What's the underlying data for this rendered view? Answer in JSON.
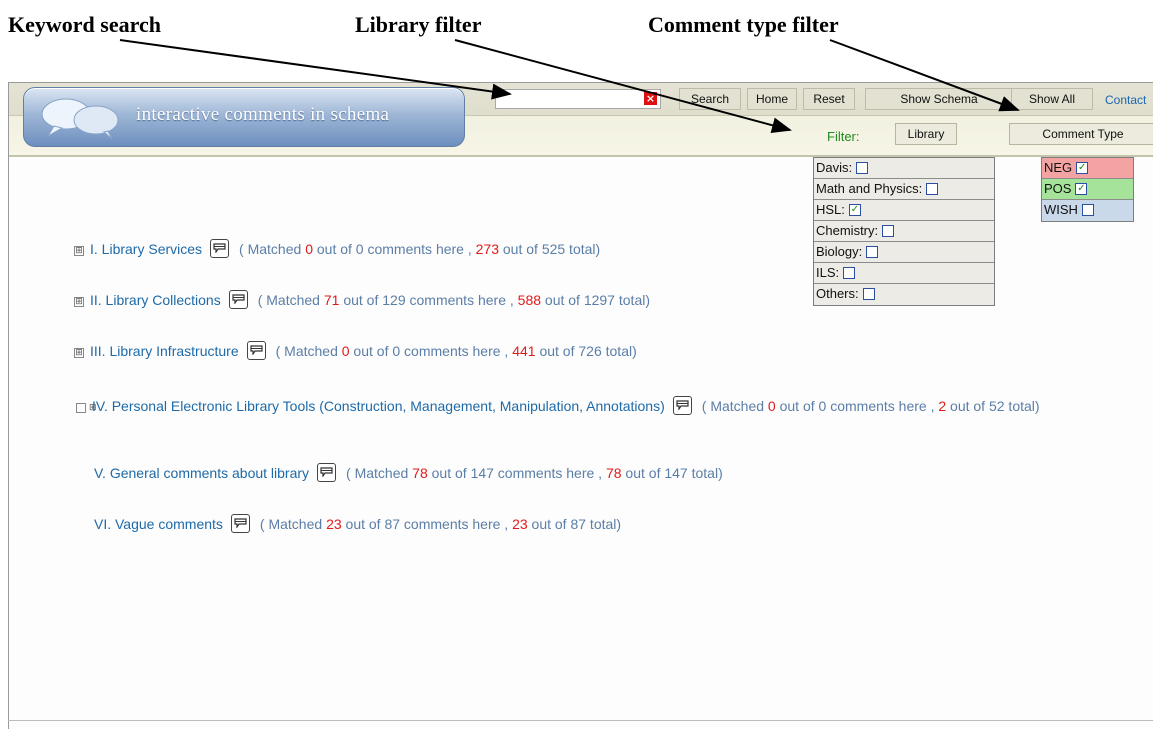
{
  "annotations": {
    "keyword_search": "Keyword search",
    "library_filter": "Library filter",
    "comment_type_filter": "Comment type filter"
  },
  "header": {
    "logo_text": "interactive comments in schema",
    "search_value": "",
    "buttons": {
      "search": "Search",
      "home": "Home",
      "reset": "Reset",
      "show_schema": "Show Schema",
      "show_all": "Show All"
    },
    "contact": "Contact",
    "filter_label": "Filter:",
    "library_button": "Library",
    "comment_type_button": "Comment Type"
  },
  "library_filter": {
    "items": [
      {
        "label": "Davis:",
        "checked": false
      },
      {
        "label": "Math and Physics:",
        "checked": false
      },
      {
        "label": "HSL:",
        "checked": true
      },
      {
        "label": "Chemistry:",
        "checked": false
      },
      {
        "label": "Biology:",
        "checked": false
      },
      {
        "label": "ILS:",
        "checked": false
      },
      {
        "label": "Others:",
        "checked": false
      }
    ]
  },
  "comment_type_filter": {
    "items": [
      {
        "label": "NEG",
        "checked": true,
        "color": "#f4a3a3"
      },
      {
        "label": "POS",
        "checked": true,
        "color": "#a6e39a"
      },
      {
        "label": "WISH",
        "checked": false,
        "color": "#c9d9ea"
      }
    ]
  },
  "tree": {
    "nodes": [
      {
        "title": "I. Library Services",
        "matched": "0",
        "here": "0",
        "total_matched": "273",
        "total": "525"
      },
      {
        "title": "II. Library Collections",
        "matched": "71",
        "here": "129",
        "total_matched": "588",
        "total": "1297"
      },
      {
        "title": "III. Library Infrastructure",
        "matched": "0",
        "here": "0",
        "total_matched": "441",
        "total": "726"
      },
      {
        "title": "IV. Personal Electronic Library Tools (Construction, Management, Manipulation, Annotations)",
        "matched": "0",
        "here": "0",
        "total_matched": "2",
        "total": "52"
      },
      {
        "title": "V. General comments about library",
        "matched": "78",
        "here": "147",
        "total_matched": "78",
        "total": "147"
      },
      {
        "title": "VI. Vague comments",
        "matched": "23",
        "here": "87",
        "total_matched": "23",
        "total": "87"
      }
    ],
    "text": {
      "matched_prefix": "( Matched ",
      "out_of": " out of ",
      "comments_here": " comments here , ",
      "total_suffix": " total)",
      "expander": "⊞"
    }
  }
}
